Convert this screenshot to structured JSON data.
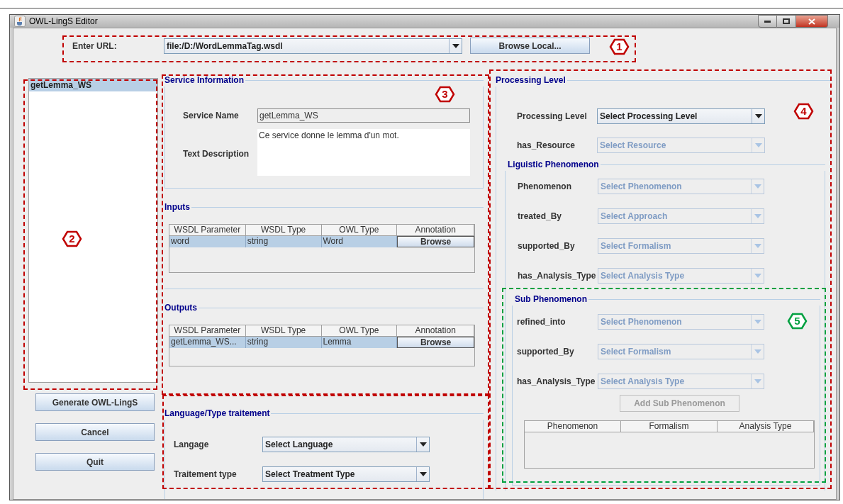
{
  "window": {
    "title": "OWL-LingS Editor"
  },
  "url": {
    "label": "Enter URL:",
    "value": "file:/D:/WordLemmaTag.wsdl",
    "browse_button": "Browse Local..."
  },
  "services": [
    {
      "label": "getLemma_WS",
      "selected": true
    }
  ],
  "buttons": [
    "Generate OWL-LingS",
    "Cancel",
    "Quit"
  ],
  "service_information": {
    "title": "Service Information",
    "name_label": "Service Name",
    "name_value": "getLemma_WS",
    "description_label": "Text Description",
    "description_value": "Ce service donne le lemma d'un mot."
  },
  "inputs": {
    "title": "Inputs",
    "columns": [
      "WSDL Parameter",
      "WSDL Type",
      "OWL Type",
      "Annotation"
    ],
    "rows": [
      {
        "selected": true,
        "cells": [
          "word",
          "string",
          "Word"
        ],
        "action": "Browse"
      }
    ]
  },
  "outputs": {
    "title": "Outputs",
    "columns": [
      "WSDL Parameter",
      "WSDL Type",
      "OWL Type",
      "Annotation"
    ],
    "rows": [
      {
        "selected": true,
        "cells": [
          "getLemma_WS...",
          "string",
          "Lemma"
        ],
        "action": "Browse"
      }
    ]
  },
  "language": {
    "title": "Language/Type traitement",
    "fields": [
      {
        "label": "Langage",
        "value": "Select Language",
        "disabled": false
      },
      {
        "label": "Traitement type",
        "value": "Select Treatment Type",
        "disabled": false
      }
    ]
  },
  "processing": {
    "title": "Processing Level",
    "fields": [
      {
        "label": "Processing Level",
        "value": "Select Processing Level",
        "disabled": false
      },
      {
        "label": "has_Resource",
        "value": "Select Resource",
        "disabled": true
      }
    ],
    "linguistic": {
      "title": "Liguistic Phenomenon",
      "fields": [
        {
          "label": "Phenomenon",
          "value": "Select Phenomenon",
          "disabled": true
        },
        {
          "label": "treated_By",
          "value": "Select Approach",
          "disabled": true
        },
        {
          "label": "supported_By",
          "value": "Select Formalism",
          "disabled": true
        },
        {
          "label": "has_Analysis_Type",
          "value": "Select Analysis Type",
          "disabled": true
        }
      ]
    },
    "sub": {
      "title": "Sub Phenomenon",
      "fields": [
        {
          "label": "refined_into",
          "value": "Select Phenomenon",
          "disabled": true
        },
        {
          "label": "supported_By",
          "value": "Select Formalism",
          "disabled": true
        },
        {
          "label": "has_Analysis_Type",
          "value": "Select Analysis Type",
          "disabled": true
        }
      ],
      "add_button": {
        "label": "Add Sub Phenomenon",
        "disabled": true
      },
      "columns": [
        "Phenomenon",
        "Formalism",
        "Analysis Type"
      ]
    }
  },
  "callouts": [
    {
      "label": "1",
      "color": "#c00000"
    },
    {
      "label": "2",
      "color": "#c00000"
    },
    {
      "label": "3",
      "color": "#c00000"
    },
    {
      "label": "4",
      "color": "#c00000"
    },
    {
      "label": "5",
      "color": "#00a040"
    }
  ]
}
